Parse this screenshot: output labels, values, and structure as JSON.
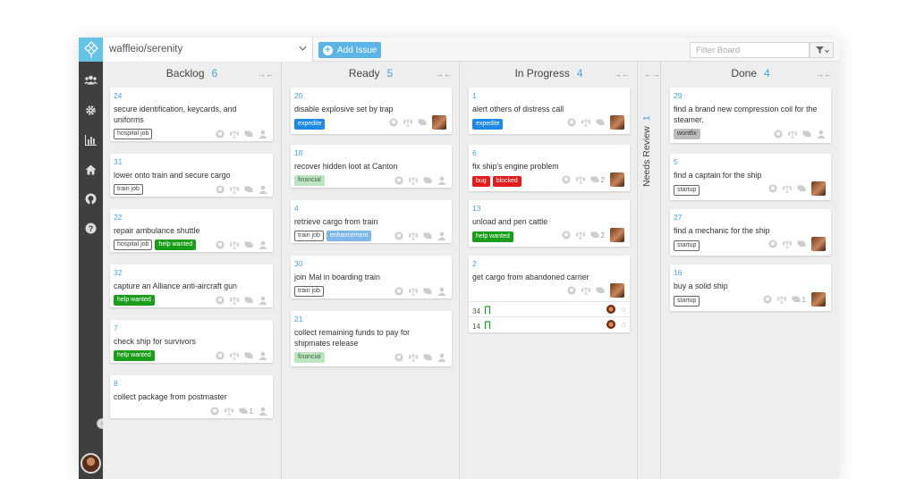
{
  "topbar": {
    "repo": "waffleio/serenity",
    "add_issue": "Add Issue",
    "filter_placeholder": "Filter Board"
  },
  "sidebar": {
    "icons": [
      "people-icon",
      "gear-icon",
      "chart-icon",
      "home-icon",
      "github-icon",
      "help-icon"
    ]
  },
  "colors": {
    "accent": "#4aa3df",
    "sidebar": "#3f3f3f"
  },
  "columns": {
    "backlog": {
      "title": "Backlog",
      "count": "6",
      "cards": [
        {
          "num": "24",
          "title": "secure identification, keycards, and uniforms",
          "labels": [
            "hospital job"
          ]
        },
        {
          "num": "31",
          "title": "lower onto train and secure cargo",
          "labels": [
            "train job"
          ]
        },
        {
          "num": "22",
          "title": "repair ambulance shuttle",
          "labels": [
            "hospital job",
            "help wanted"
          ]
        },
        {
          "num": "32",
          "title": "capture an Alliance anti-aircraft gun",
          "labels": [
            "help wanted"
          ]
        },
        {
          "num": "7",
          "title": "check ship for survivors",
          "labels": [
            "help wanted"
          ]
        },
        {
          "num": "8",
          "title": "collect package from postmaster",
          "labels": [],
          "comments": "1"
        }
      ]
    },
    "ready": {
      "title": "Ready",
      "count": "5",
      "cards": [
        {
          "num": "20",
          "title": "disable explosive set by trap",
          "labels": [
            "expedite"
          ]
        },
        {
          "num": "18",
          "title": "recover hidden loot at Canton",
          "labels": [
            "financial"
          ]
        },
        {
          "num": "4",
          "title": "retrieve cargo from train",
          "labels": [
            "train job",
            "enhancement"
          ]
        },
        {
          "num": "30",
          "title": "join Mal in boarding train",
          "labels": [
            "train job"
          ]
        },
        {
          "num": "21",
          "title": "collect remaining funds to pay for shipmates release",
          "labels": [
            "financial"
          ]
        }
      ]
    },
    "in_progress": {
      "title": "In Progress",
      "count": "4",
      "cards": [
        {
          "num": "1",
          "title": "alert others of distress call",
          "labels": [
            "expedite"
          ]
        },
        {
          "num": "6",
          "title": "fix ship's engine problem",
          "labels": [
            "bug",
            "blocked"
          ],
          "comments": "2"
        },
        {
          "num": "13",
          "title": "unload and pen cattle",
          "labels": [
            "help wanted"
          ],
          "comments": "2"
        },
        {
          "num": "2",
          "title": "get cargo from abandoned carrier",
          "labels": [],
          "prs": [
            {
              "num": "34",
              "count": "0"
            },
            {
              "num": "14",
              "count": "0"
            }
          ]
        }
      ]
    },
    "needs_review": {
      "title": "Needs Review",
      "count": "1"
    },
    "done": {
      "title": "Done",
      "count": "4",
      "cards": [
        {
          "num": "29",
          "title": "find a brand new compression coil for the steamer.",
          "labels": [
            "wontfix"
          ]
        },
        {
          "num": "5",
          "title": "find a captain for the ship",
          "labels": [
            "startup"
          ]
        },
        {
          "num": "27",
          "title": "find a mechanic for the ship",
          "labels": [
            "startup"
          ]
        },
        {
          "num": "16",
          "title": "buy a solid ship",
          "labels": [
            "startup"
          ],
          "comments": "1"
        }
      ]
    }
  }
}
